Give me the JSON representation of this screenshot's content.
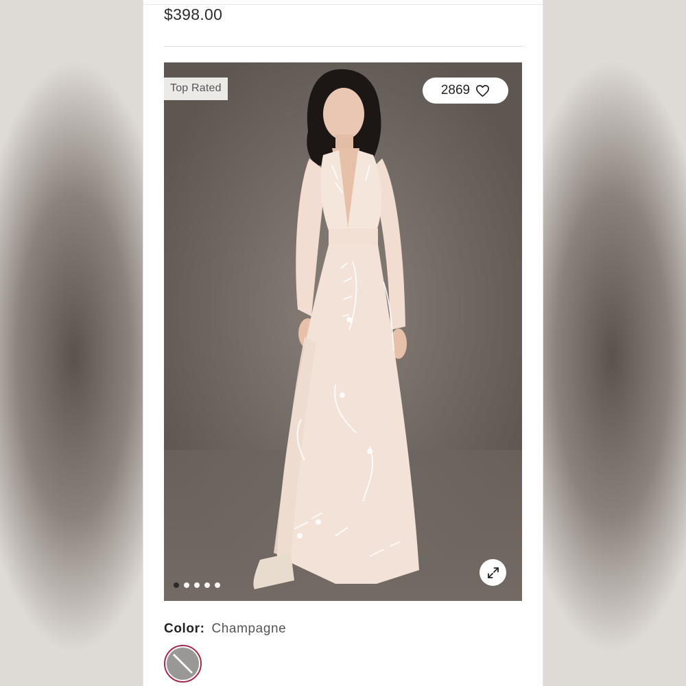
{
  "product": {
    "price": "$398.00",
    "badge": "Top Rated",
    "likes_count": "2869",
    "image_alt": "Model wearing long-sleeve champagne embroidered maxi gown",
    "carousel": {
      "total_slides": 5,
      "active_index": 0
    },
    "color": {
      "label": "Color:",
      "value": "Champagne",
      "swatch_state": "unavailable"
    }
  },
  "icons": {
    "like": "heart-icon",
    "expand": "expand-icon",
    "swatch": "strikethrough-swatch-icon"
  },
  "colors": {
    "swatch_ring": "#a52a4a",
    "swatch_fill": "#9a9896",
    "image_background": "#6f6761"
  }
}
